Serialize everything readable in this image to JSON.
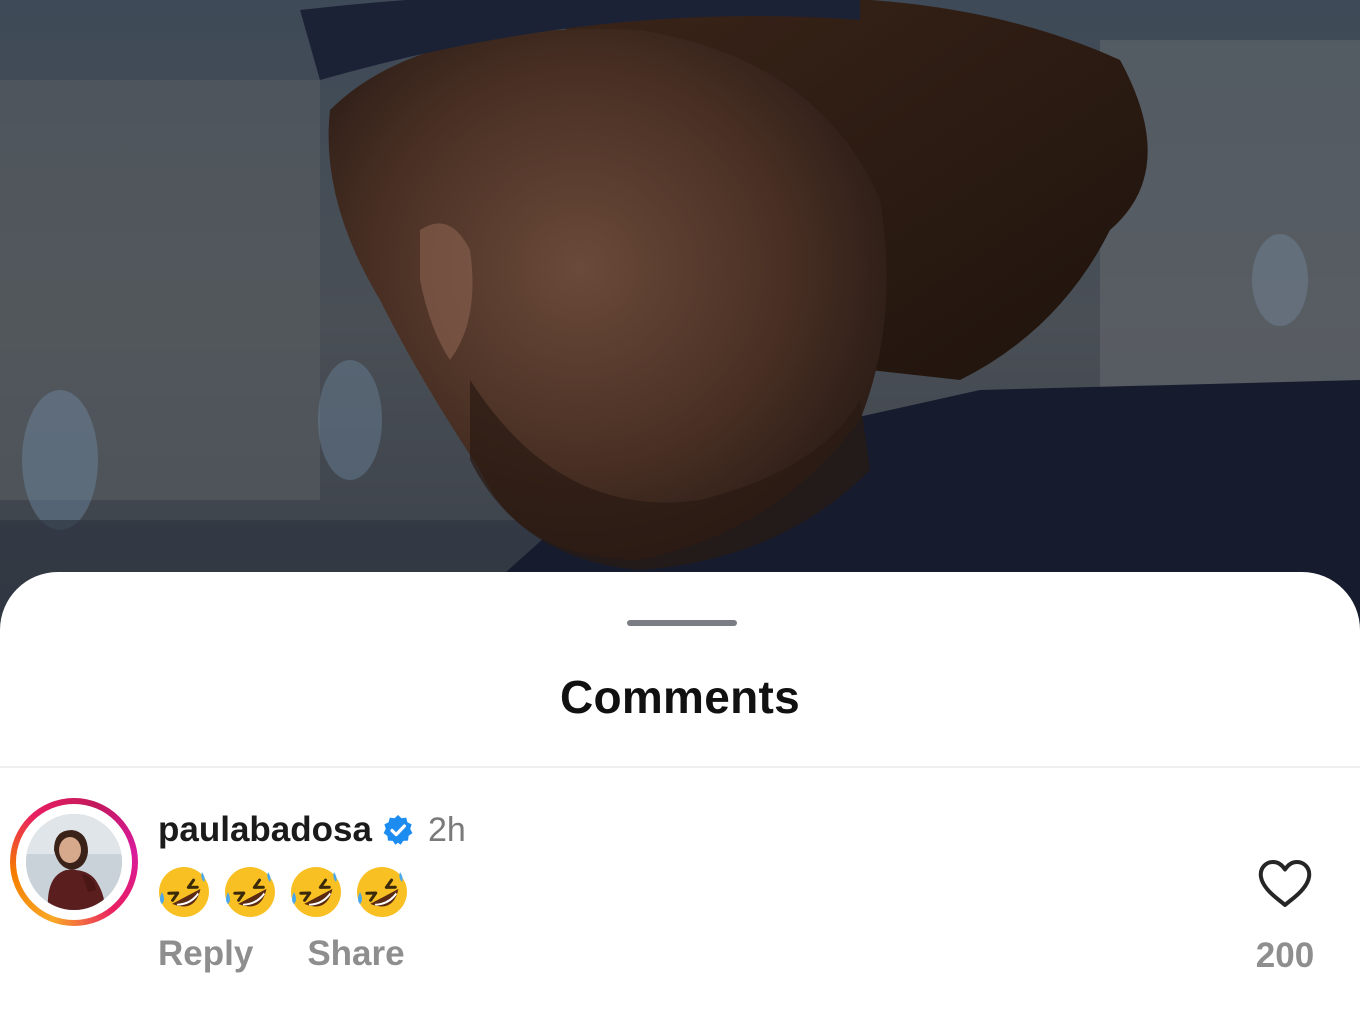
{
  "sheet": {
    "title": "Comments"
  },
  "comment": {
    "username": "paulabadosa",
    "verified_icon": "verified-badge-icon",
    "time": "2h",
    "text": "🤣🤣🤣🤣",
    "reply_label": "Reply",
    "share_label": "Share",
    "like_icon": "heart-outline-icon",
    "like_count": "200"
  },
  "colors": {
    "verified_blue": "#1d8cf0",
    "story_ring_start": "#f9a825",
    "story_ring_end": "#d81b9c",
    "muted_text": "#8e8e8e"
  }
}
